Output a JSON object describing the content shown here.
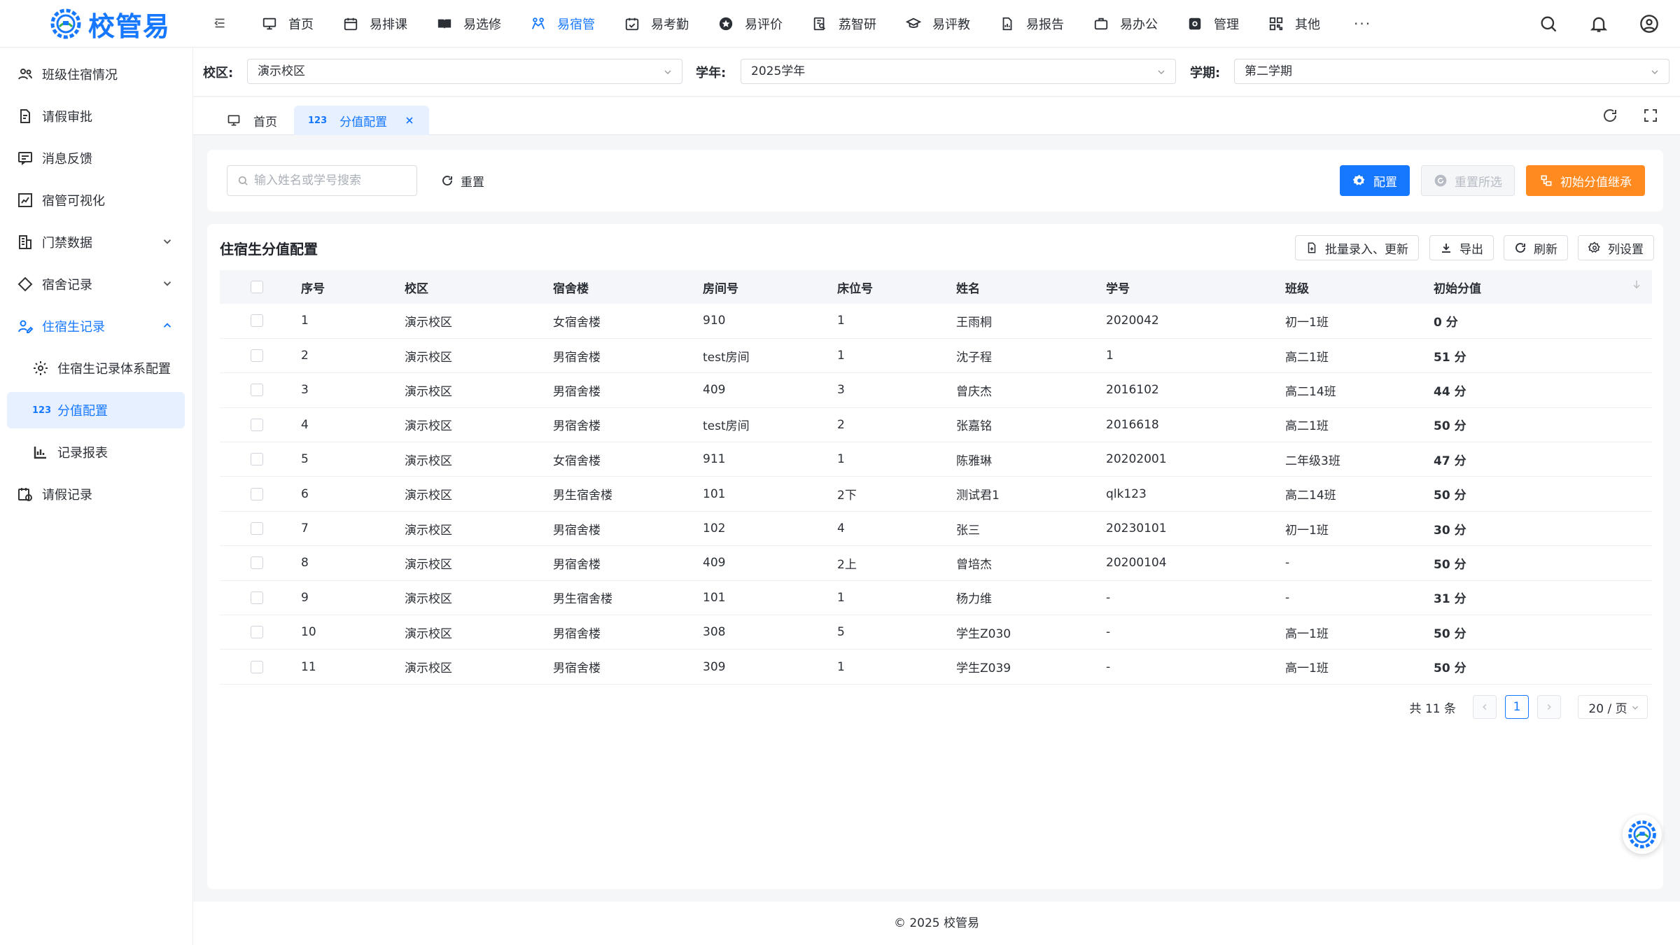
{
  "app": {
    "logo_text": "校管易"
  },
  "topnav": [
    {
      "label": "首页",
      "icon": "monitor-icon"
    },
    {
      "label": "易排课",
      "icon": "calendar-icon"
    },
    {
      "label": "易选修",
      "icon": "book-icon"
    },
    {
      "label": "易宿管",
      "icon": "dorm-icon",
      "active": true
    },
    {
      "label": "易考勤",
      "icon": "calendar-check-icon"
    },
    {
      "label": "易评价",
      "icon": "star-icon"
    },
    {
      "label": "荔智研",
      "icon": "research-icon"
    },
    {
      "label": "易评教",
      "icon": "graduation-cap-icon"
    },
    {
      "label": "易报告",
      "icon": "report-icon"
    },
    {
      "label": "易办公",
      "icon": "briefcase-icon"
    },
    {
      "label": "管理",
      "icon": "gear-icon"
    },
    {
      "label": "其他",
      "icon": "grid-icon"
    }
  ],
  "topnav_more": "···",
  "sidebar": {
    "items": [
      {
        "label": "班级住宿情况"
      },
      {
        "label": "请假审批"
      },
      {
        "label": "消息反馈"
      },
      {
        "label": "宿管可视化"
      },
      {
        "label": "门禁数据"
      },
      {
        "label": "宿舍记录"
      },
      {
        "label": "住宿生记录"
      },
      {
        "label": "住宿生记录体系配置"
      },
      {
        "label": "分值配置",
        "badge": "123"
      },
      {
        "label": "记录报表"
      },
      {
        "label": "请假记录"
      }
    ]
  },
  "filters": {
    "campus_label": "校区:",
    "campus_value": "演示校区",
    "year_label": "学年:",
    "year_value": "2025学年",
    "term_label": "学期:",
    "term_value": "第二学期"
  },
  "tabs": [
    {
      "label": "首页"
    },
    {
      "label": "分值配置",
      "badge": "123"
    }
  ],
  "search": {
    "placeholder": "输入姓名或学号搜索",
    "reset_label": "重置",
    "config_label": "配置",
    "reset_selected_label": "重置所选",
    "inherit_label": "初始分值继承"
  },
  "table": {
    "title": "住宿生分值配置",
    "tools": {
      "batch_label": "批量录入、更新",
      "export_label": "导出",
      "refresh_label": "刷新",
      "columns_label": "列设置"
    },
    "headers": [
      "序号",
      "校区",
      "宿舍楼",
      "房间号",
      "床位号",
      "姓名",
      "学号",
      "班级",
      "初始分值"
    ],
    "rows": [
      [
        "1",
        "演示校区",
        "女宿舍楼",
        "910",
        "1",
        "王雨桐",
        "2020042",
        "初一1班",
        "0 分"
      ],
      [
        "2",
        "演示校区",
        "男宿舍楼",
        "test房间",
        "1",
        "沈子程",
        "1",
        "高二1班",
        "51 分"
      ],
      [
        "3",
        "演示校区",
        "男宿舍楼",
        "409",
        "3",
        "曾庆杰",
        "2016102",
        "高二14班",
        "44 分"
      ],
      [
        "4",
        "演示校区",
        "男宿舍楼",
        "test房间",
        "2",
        "张嘉铭",
        "2016618",
        "高二1班",
        "50 分"
      ],
      [
        "5",
        "演示校区",
        "女宿舍楼",
        "911",
        "1",
        "陈雅琳",
        "20202001",
        "二年级3班",
        "47 分"
      ],
      [
        "6",
        "演示校区",
        "男生宿舍楼",
        "101",
        "2下",
        "测试君1",
        "qlk123",
        "高二14班",
        "50 分"
      ],
      [
        "7",
        "演示校区",
        "男宿舍楼",
        "102",
        "4",
        "张三",
        "20230101",
        "初一1班",
        "30 分"
      ],
      [
        "8",
        "演示校区",
        "男宿舍楼",
        "409",
        "2上",
        "曾培杰",
        "20200104",
        "-",
        "50 分"
      ],
      [
        "9",
        "演示校区",
        "男生宿舍楼",
        "101",
        "1",
        "杨力维",
        "-",
        "-",
        "31 分"
      ],
      [
        "10",
        "演示校区",
        "男宿舍楼",
        "308",
        "5",
        "学生Z030",
        "-",
        "高一1班",
        "50 分"
      ],
      [
        "11",
        "演示校区",
        "男宿舍楼",
        "309",
        "1",
        "学生Z039",
        "-",
        "高一1班",
        "50 分"
      ]
    ]
  },
  "pager": {
    "total_text": "共 11 条",
    "current_page": "1",
    "page_size": "20 / 页"
  },
  "footer": {
    "text": "© 2025 校管易"
  },
  "colors": {
    "primary": "#1677ff",
    "orange": "#ff8a1f",
    "selected_bg": "#e6f0ff"
  }
}
